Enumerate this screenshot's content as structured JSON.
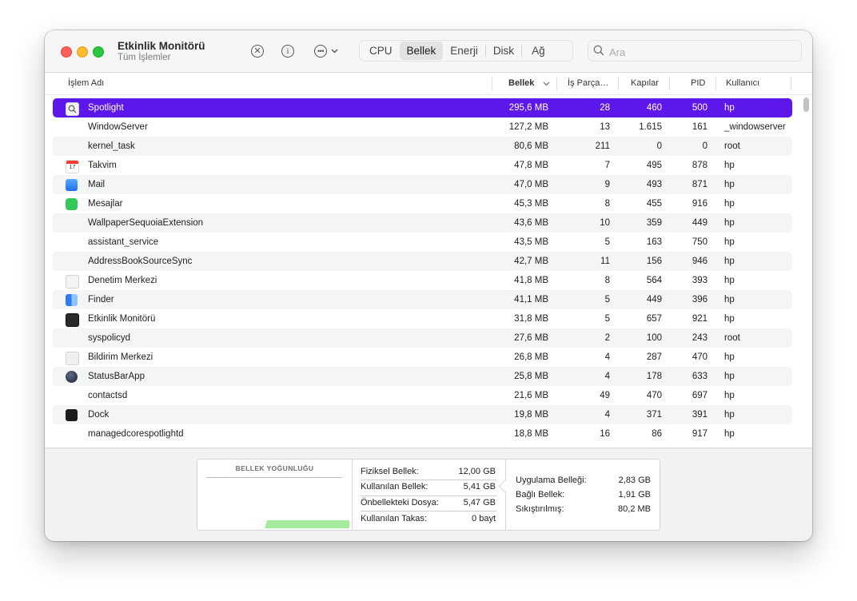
{
  "window": {
    "title": "Etkinlik Monitörü",
    "subtitle": "Tüm İşlemler"
  },
  "toolbar": {
    "stop_icon": "x-circle-icon",
    "info_icon": "info-circle-icon",
    "more_icon": "ellipsis-circle-icon",
    "tabs": [
      {
        "label": "CPU",
        "active": false
      },
      {
        "label": "Bellek",
        "active": true
      },
      {
        "label": "Enerji",
        "active": false
      },
      {
        "label": "Disk",
        "active": false
      },
      {
        "label": "Ağ",
        "active": false
      }
    ],
    "search_placeholder": "Ara",
    "search_value": ""
  },
  "columns": {
    "name": "İşlem Adı",
    "memory": "Bellek",
    "threads": "İş Parça…",
    "ports": "Kapılar",
    "pid": "PID",
    "user": "Kullanıcı",
    "sort_indicator": "chevron-down-icon"
  },
  "processes": [
    {
      "name": "Spotlight",
      "icon": "spotlight-icon",
      "memory": "295,6 MB",
      "threads": "28",
      "ports": "460",
      "pid": "500",
      "user": "hp"
    },
    {
      "name": "WindowServer",
      "icon": "",
      "memory": "127,2 MB",
      "threads": "13",
      "ports": "1.615",
      "pid": "161",
      "user": "_windowserver"
    },
    {
      "name": "kernel_task",
      "icon": "",
      "memory": "80,6 MB",
      "threads": "211",
      "ports": "0",
      "pid": "0",
      "user": "root"
    },
    {
      "name": "Takvim",
      "icon": "calendar-icon",
      "memory": "47,8 MB",
      "threads": "7",
      "ports": "495",
      "pid": "878",
      "user": "hp"
    },
    {
      "name": "Mail",
      "icon": "mail-icon",
      "memory": "47,0 MB",
      "threads": "9",
      "ports": "493",
      "pid": "871",
      "user": "hp"
    },
    {
      "name": "Mesajlar",
      "icon": "messages-icon",
      "memory": "45,3 MB",
      "threads": "8",
      "ports": "455",
      "pid": "916",
      "user": "hp"
    },
    {
      "name": "WallpaperSequoiaExtension",
      "icon": "",
      "memory": "43,6 MB",
      "threads": "10",
      "ports": "359",
      "pid": "449",
      "user": "hp"
    },
    {
      "name": "assistant_service",
      "icon": "",
      "memory": "43,5 MB",
      "threads": "5",
      "ports": "163",
      "pid": "750",
      "user": "hp"
    },
    {
      "name": "AddressBookSourceSync",
      "icon": "",
      "memory": "42,7 MB",
      "threads": "11",
      "ports": "156",
      "pid": "946",
      "user": "hp"
    },
    {
      "name": "Denetim Merkezi",
      "icon": "control-center-icon",
      "memory": "41,8 MB",
      "threads": "8",
      "ports": "564",
      "pid": "393",
      "user": "hp"
    },
    {
      "name": "Finder",
      "icon": "finder-icon",
      "memory": "41,1 MB",
      "threads": "5",
      "ports": "449",
      "pid": "396",
      "user": "hp"
    },
    {
      "name": "Etkinlik Monitörü",
      "icon": "activity-monitor-icon",
      "memory": "31,8 MB",
      "threads": "5",
      "ports": "657",
      "pid": "921",
      "user": "hp"
    },
    {
      "name": "syspolicyd",
      "icon": "",
      "memory": "27,6 MB",
      "threads": "2",
      "ports": "100",
      "pid": "243",
      "user": "root"
    },
    {
      "name": "Bildirim Merkezi",
      "icon": "notification-center-icon",
      "memory": "26,8 MB",
      "threads": "4",
      "ports": "287",
      "pid": "470",
      "user": "hp"
    },
    {
      "name": "StatusBarApp",
      "icon": "statusbar-app-icon",
      "memory": "25,8 MB",
      "threads": "4",
      "ports": "178",
      "pid": "633",
      "user": "hp"
    },
    {
      "name": "contactsd",
      "icon": "",
      "memory": "21,6 MB",
      "threads": "49",
      "ports": "470",
      "pid": "697",
      "user": "hp"
    },
    {
      "name": "Dock",
      "icon": "dock-icon",
      "memory": "19,8 MB",
      "threads": "4",
      "ports": "371",
      "pid": "391",
      "user": "hp"
    },
    {
      "name": "managedcorespotlightd",
      "icon": "",
      "memory": "18,8 MB",
      "threads": "16",
      "ports": "86",
      "pid": "917",
      "user": "hp"
    }
  ],
  "memory_panel": {
    "pressure_title": "BELLEK YOĞUNLUĞU",
    "pressure_color": "#a4ec9c",
    "stats_left": [
      {
        "label": "Fiziksel Bellek:",
        "value": "12,00 GB"
      },
      {
        "label": "Kullanılan Bellek:",
        "value": "5,41 GB"
      },
      {
        "label": "Önbellekteki Dosya:",
        "value": "5,47 GB"
      },
      {
        "label": "Kullanılan Takas:",
        "value": "0 bayt"
      }
    ],
    "stats_right": [
      {
        "label": "Uygulama Belleği:",
        "value": "2,83 GB"
      },
      {
        "label": "Bağlı Bellek:",
        "value": "1,91 GB"
      },
      {
        "label": "Sıkıştırılmış:",
        "value": "80,2 MB"
      }
    ]
  },
  "colors": {
    "selection": "#5d17eb",
    "close": "#ff5f57",
    "minimize": "#febc2e",
    "maximize": "#28c840"
  }
}
